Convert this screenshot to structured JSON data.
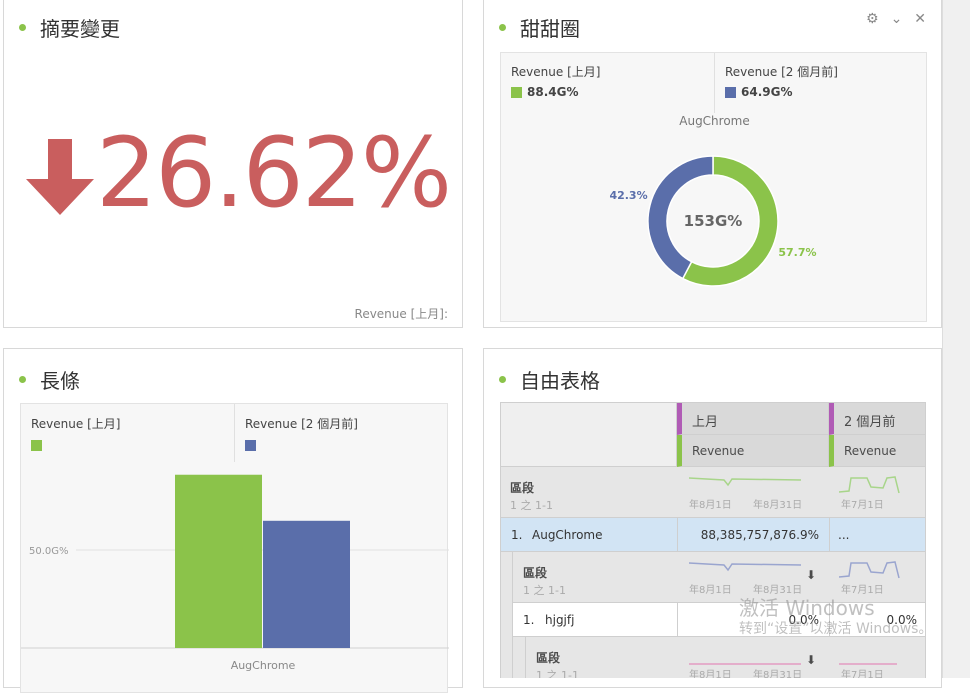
{
  "summary": {
    "title": "摘要變更",
    "value": "26.62%",
    "direction": "down",
    "footer": "Revenue [上月]:",
    "color": "#c95e5e"
  },
  "donut": {
    "title": "甜甜圈",
    "legend": [
      {
        "label": "Revenue [上月]",
        "value": "88.4G%",
        "color": "#8bc34a"
      },
      {
        "label": "Revenue [2 個月前]",
        "value": "64.9G%",
        "color": "#5a6eaa"
      }
    ],
    "chart_data": {
      "type": "pie",
      "title": "AugChrome",
      "center_label": "153G%",
      "slices": [
        {
          "name": "Revenue [上月]",
          "value": 57.7,
          "label": "57.7%",
          "color": "#8bc34a"
        },
        {
          "name": "Revenue [2 個月前]",
          "value": 42.3,
          "label": "42.3%",
          "color": "#5a6eaa"
        }
      ]
    }
  },
  "bar": {
    "title": "長條",
    "chart_data": {
      "type": "bar",
      "categories": [
        "AugChrome"
      ],
      "series": [
        {
          "name": "Revenue [上月]",
          "values": [
            88.4
          ],
          "color": "#8bc34a"
        },
        {
          "name": "Revenue [2 個月前]",
          "values": [
            64.9
          ],
          "color": "#5a6eaa"
        }
      ],
      "ytick": "50.0G%",
      "ytick_value": 50,
      "xlabel": "AugChrome",
      "unit": "G%"
    }
  },
  "table": {
    "title": "自由表格",
    "col1": "上月",
    "col2": "2 個月前",
    "metric": "Revenue",
    "seg": "區段",
    "seg_count": "1 之 1-1",
    "d1": "年8月1日",
    "d2": "年8月31日",
    "d3": "年7月1日",
    "row1": {
      "num": "1.",
      "name": "AugChrome",
      "v1": "88,385,757,876.9%",
      "v2": "..."
    },
    "row2": {
      "num": "1.",
      "name": "hjgjfj",
      "v1": "0.0%",
      "v2": "0.0%"
    }
  },
  "watermark": {
    "line1": "激活 Windows",
    "line2": "转到“设置”以激活 Windows。"
  }
}
